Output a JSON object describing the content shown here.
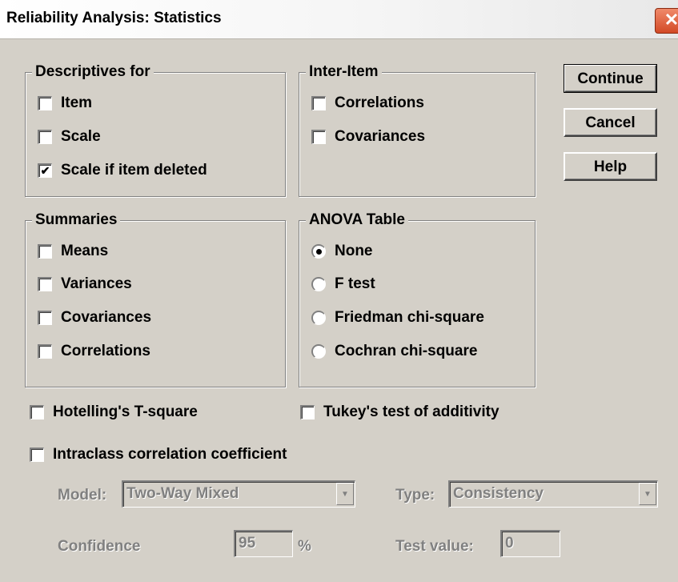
{
  "window": {
    "title": "Reliability Analysis: Statistics",
    "close_glyph": "✕"
  },
  "descriptives": {
    "legend": "Descriptives for",
    "items": [
      {
        "label": "Item",
        "checked": false
      },
      {
        "label": "Scale",
        "checked": false
      },
      {
        "label": "Scale if item deleted",
        "checked": true
      }
    ]
  },
  "inter_item": {
    "legend": "Inter-Item",
    "items": [
      {
        "label": "Correlations",
        "checked": false
      },
      {
        "label": "Covariances",
        "checked": false
      }
    ]
  },
  "summaries": {
    "legend": "Summaries",
    "items": [
      {
        "label": "Means",
        "checked": false
      },
      {
        "label": "Variances",
        "checked": false
      },
      {
        "label": "Covariances",
        "checked": false
      },
      {
        "label": "Correlations",
        "checked": false
      }
    ]
  },
  "anova": {
    "legend": "ANOVA Table",
    "options": [
      {
        "label": "None",
        "selected": true
      },
      {
        "label": "F test",
        "selected": false
      },
      {
        "label": "Friedman chi-square",
        "selected": false
      },
      {
        "label": "Cochran chi-square",
        "selected": false
      }
    ]
  },
  "buttons": {
    "continue": "Continue",
    "cancel": "Cancel",
    "help": "Help"
  },
  "options": {
    "hotelling": "Hotelling's T-square",
    "tukey": "Tukey's test of additivity",
    "intraclass": "Intraclass correlation coefficient"
  },
  "icc": {
    "model_label": "Model:",
    "model_value": "Two-Way Mixed",
    "type_label": "Type:",
    "type_value": "Consistency",
    "confidence_label": "Confidence",
    "confidence_value": "95",
    "percent": "%",
    "test_value_label": "Test value:",
    "test_value": "0"
  },
  "glyphs": {
    "check": "✔",
    "dropdown": "▼"
  },
  "colors": {
    "face": "#d4d0c8",
    "disabled_text": "#808080",
    "close_red": "#d34a26"
  }
}
